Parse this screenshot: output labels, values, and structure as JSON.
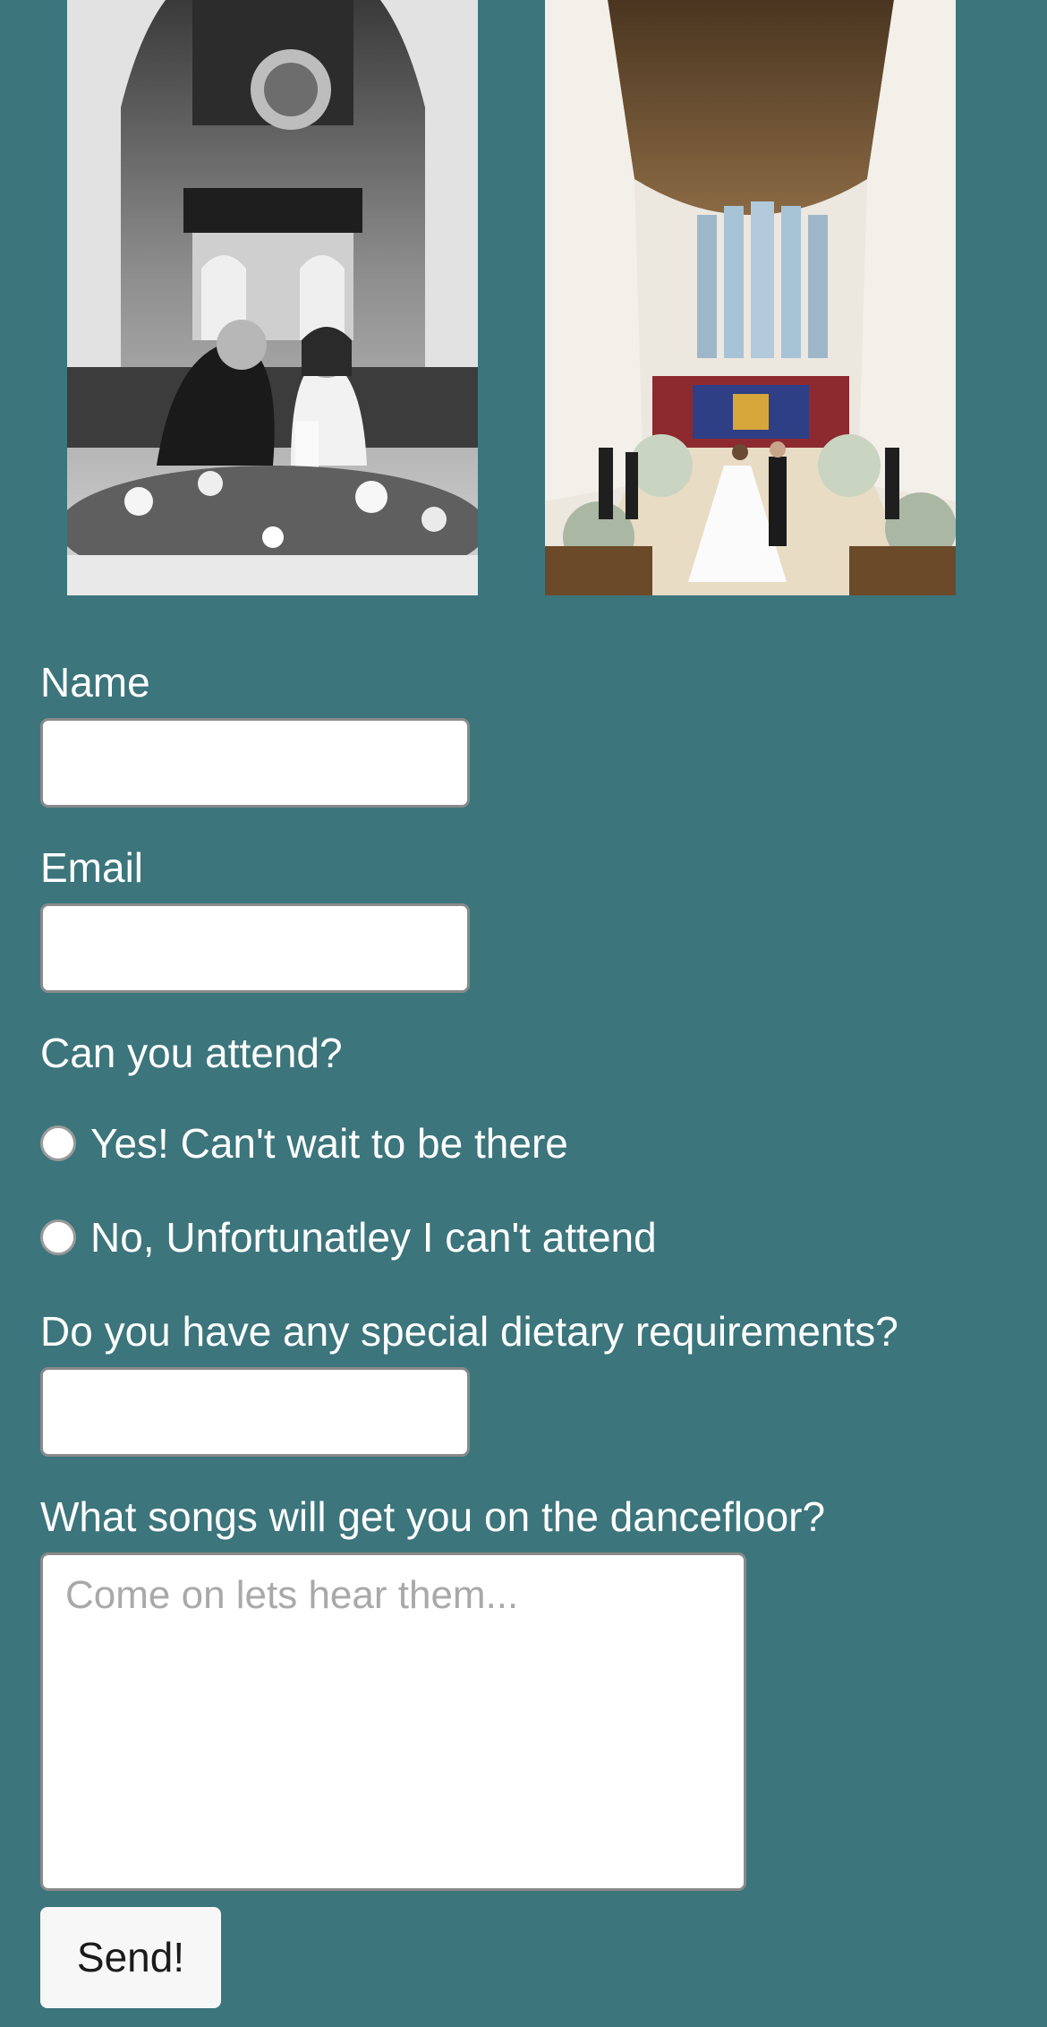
{
  "photos": [
    {
      "name": "ceremony-candle-photo",
      "style": "black-and-white"
    },
    {
      "name": "church-altar-photo",
      "style": "color"
    }
  ],
  "form": {
    "name_label": "Name",
    "name_value": "",
    "email_label": "Email",
    "email_value": "",
    "attend_label": "Can you attend?",
    "attend_options": [
      {
        "label": "Yes! Can't wait to be there",
        "selected": false
      },
      {
        "label": "No, Unfortunatley I can't attend",
        "selected": false
      }
    ],
    "dietary_label": "Do you have any special dietary requirements?",
    "dietary_value": "",
    "songs_label": "What songs will get you on the dancefloor?",
    "songs_placeholder": "Come on lets hear them...",
    "send_label": "Send!"
  },
  "colors": {
    "background": "#3c757c",
    "input_background": "#ffffff",
    "button_background": "#f7f7f7"
  }
}
